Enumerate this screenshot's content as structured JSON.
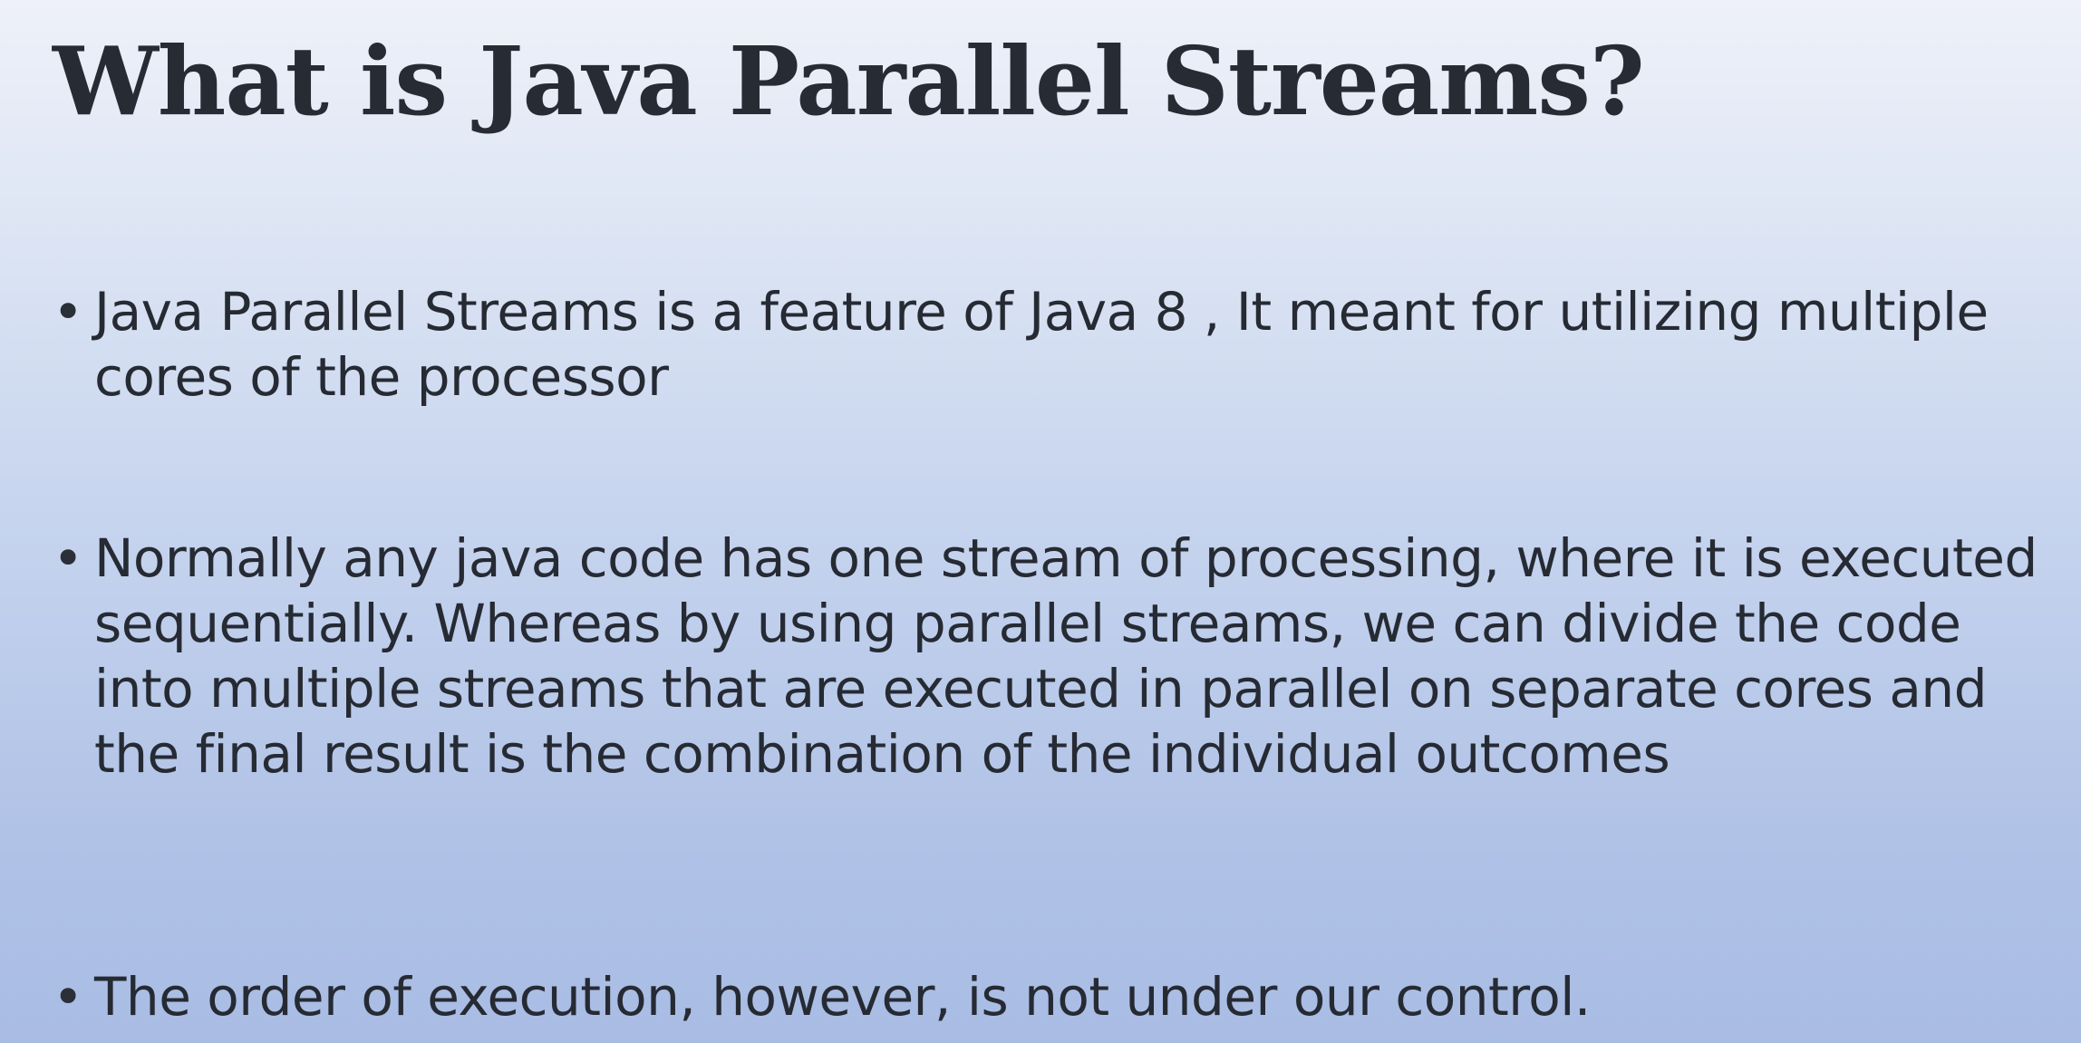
{
  "slide": {
    "title": "What is Java Parallel Streams?",
    "bullet_glyph": "•",
    "bullets": [
      {
        "text": "Java Parallel Streams is a feature of Java 8 , It meant for utilizing multiple cores of the processor"
      },
      {
        "text": "Normally any java code has one stream of processing, where it is executed sequentially. Whereas by using parallel streams, we can divide the code into multiple streams that are executed in parallel on separate cores and the final result is the combination of the individual outcomes"
      },
      {
        "text": "The order of execution, however, is not under our control."
      }
    ]
  },
  "colors": {
    "background_top": "#eef1f9",
    "background_bottom": "#a9bce4",
    "text": "#262a33"
  }
}
